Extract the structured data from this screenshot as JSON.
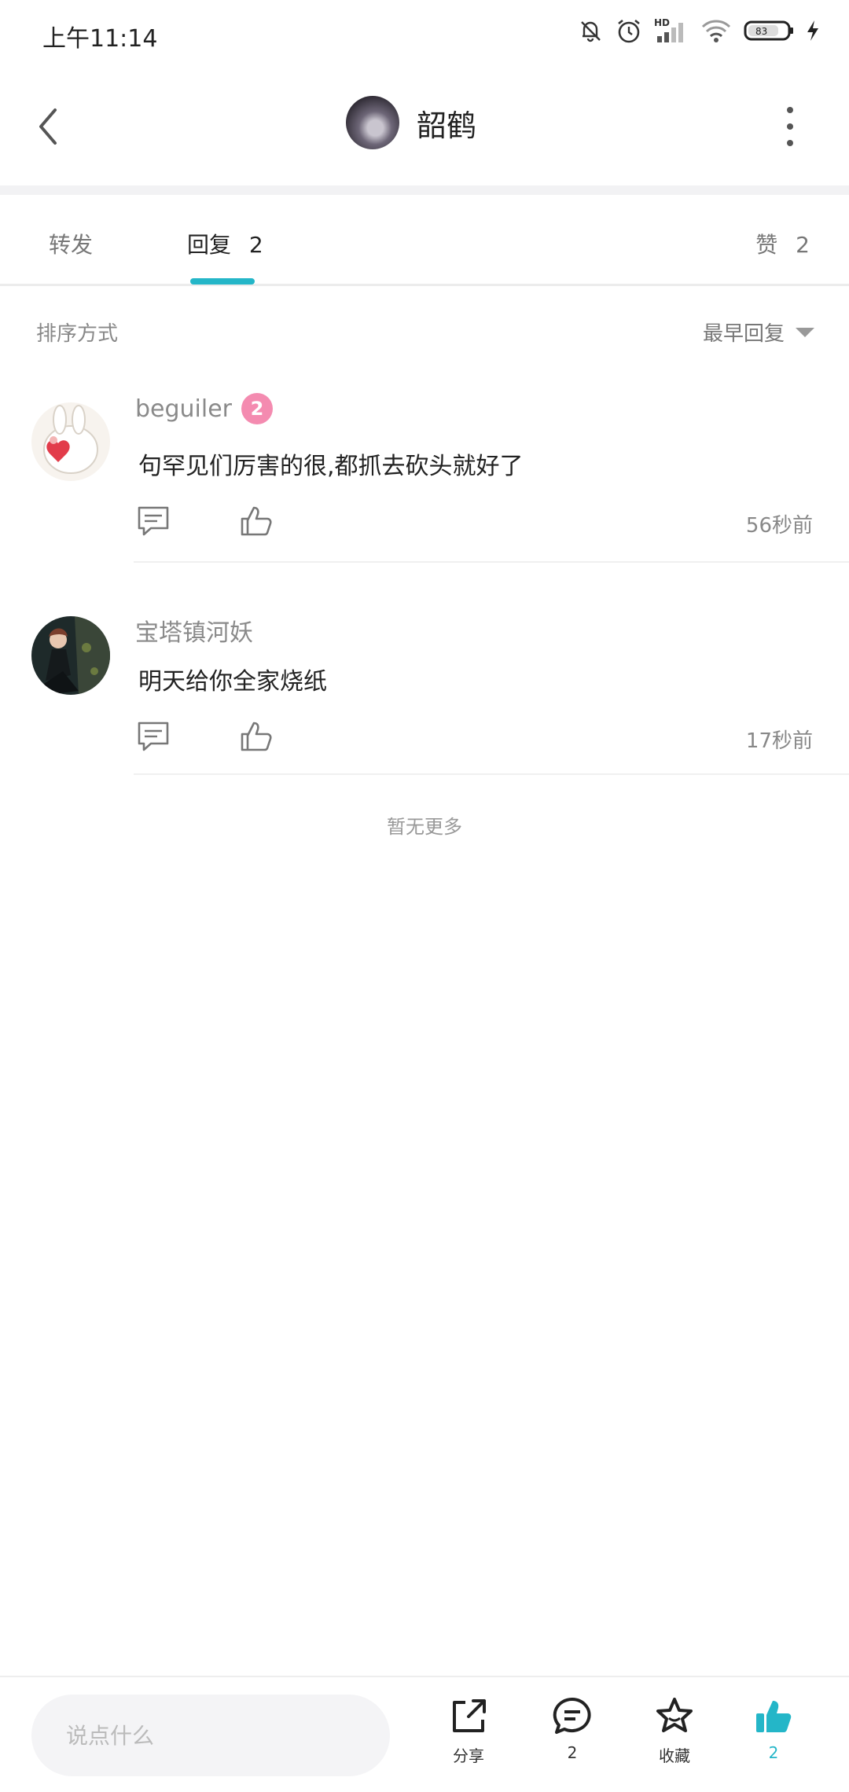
{
  "status_bar": {
    "time": "上午11:14",
    "network": "HD",
    "battery": "83"
  },
  "header": {
    "title": "韶鹤"
  },
  "tabs": [
    {
      "label": "转发",
      "count": ""
    },
    {
      "label": "回复",
      "count": "2"
    },
    {
      "label": "赞",
      "count": "2"
    }
  ],
  "sort": {
    "label": "排序方式",
    "selected": "最早回复"
  },
  "comments": [
    {
      "username": "beguiler",
      "badge": "2",
      "text": "句罕见们厉害的很,都抓去砍头就好了",
      "time": "56秒前"
    },
    {
      "username": "宝塔镇河妖",
      "badge": "",
      "text": "明天给你全家烧纸",
      "time": "17秒前"
    }
  ],
  "footer_note": "暂无更多",
  "bottom_bar": {
    "input_placeholder": "说点什么",
    "share_label": "分享",
    "comment_count": "2",
    "collect_label": "收藏",
    "like_count": "2",
    "accent_color": "#24b6c8"
  }
}
